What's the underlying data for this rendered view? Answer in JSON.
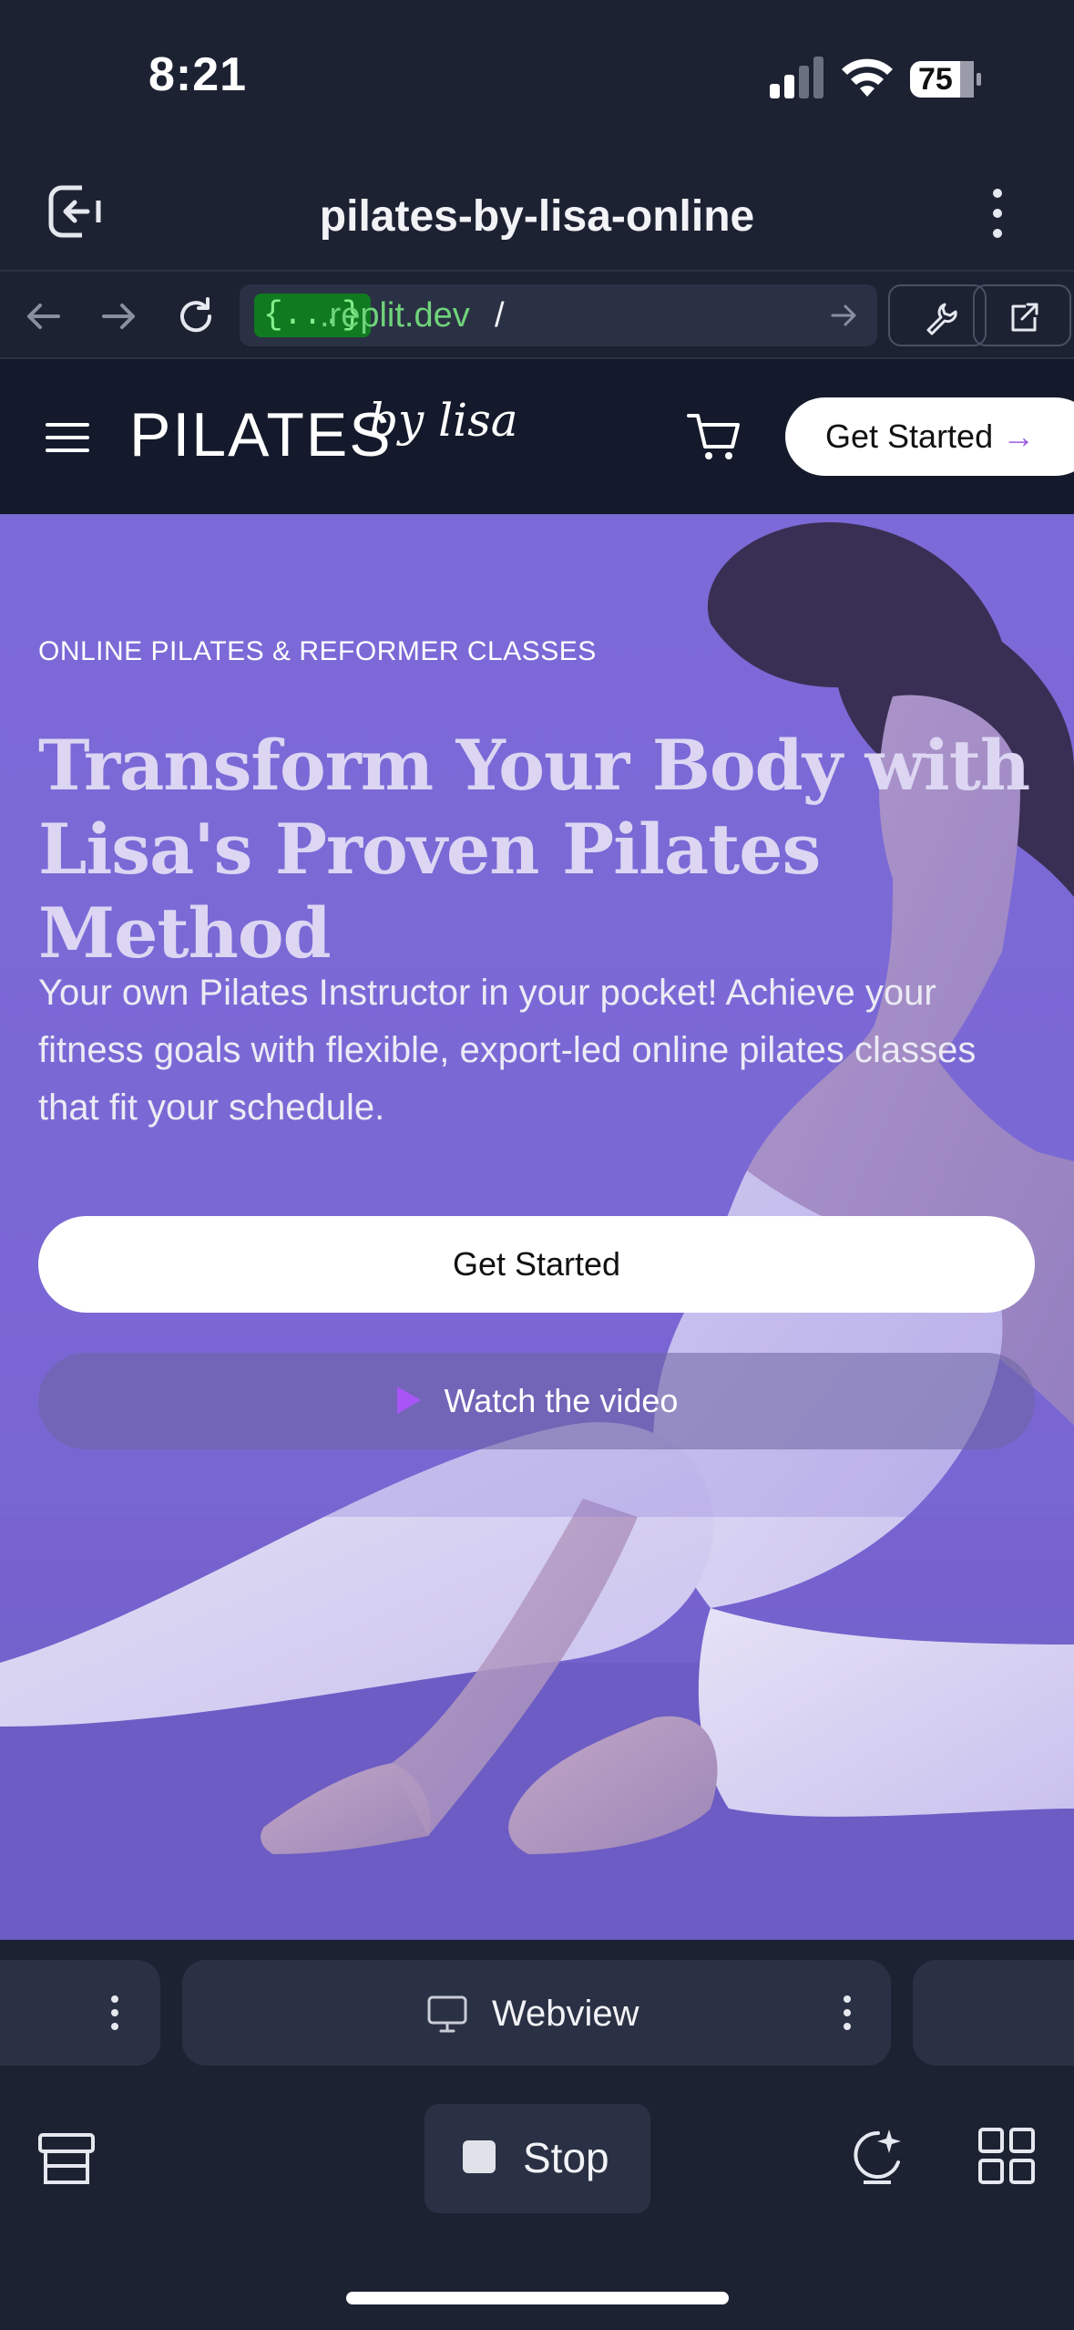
{
  "status_bar": {
    "time": "8:21",
    "battery": "75",
    "icons": [
      "cellular-signal-icon",
      "wifi-icon",
      "battery-icon"
    ]
  },
  "app_header": {
    "title": "pilates-by-lisa-online",
    "icons": [
      "exit-icon",
      "more-vertical-icon"
    ]
  },
  "url_bar": {
    "badge": "{...}",
    "domain": ".replit.dev",
    "path": "/",
    "icons": [
      "back-arrow-icon",
      "forward-arrow-icon",
      "reload-icon",
      "go-arrow-icon",
      "wrench-icon",
      "external-link-icon"
    ]
  },
  "site": {
    "logo_main": "PILATES",
    "logo_script": "by lisa",
    "nav_cta": "Get Started",
    "nav_cta_arrow": "→",
    "eyebrow": "ONLINE PILATES & REFORMER CLASSES",
    "headline_line1": "Transform Your Body with",
    "headline_line2": "Lisa's Proven Pilates Method",
    "lead": "Your own Pilates Instructor in your pocket! Achieve your fitness goals with flexible, export-led online pilates classes that fit your schedule.",
    "primary_cta": "Get Started",
    "video_cta": "Watch the video",
    "colors": {
      "hero_bg": "#7a6ad6",
      "nav_bg": "#141a2b",
      "accent": "#9b5de5"
    }
  },
  "tab_strip": {
    "active_tab": "Webview"
  },
  "bottom_bar": {
    "stop_label": "Stop",
    "icons": [
      "layers-icon",
      "ai-assistant-icon",
      "grid-icon"
    ]
  },
  "colors": {
    "chrome_bg": "#1d2233",
    "chrome_surface": "#2b3144",
    "url_green": "#6fd37a"
  }
}
